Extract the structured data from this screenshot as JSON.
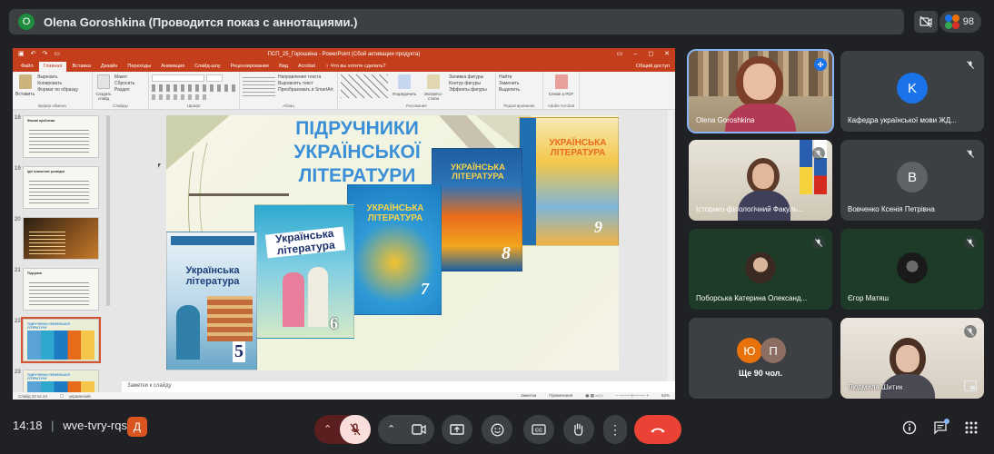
{
  "top_bar": {
    "presenter_initial": "O",
    "title": "Olena Goroshkina (Проводится показ с аннотациями.)",
    "participant_count": "98"
  },
  "ppt": {
    "window_title": "ПСП_25_Горошкіна - PowerPoint (Сбой активации продукта)",
    "tabs": [
      "Файл",
      "Главная",
      "Вставка",
      "Дизайн",
      "Переходы",
      "Анимация",
      "Слайд-шоу",
      "Рецензирование",
      "Вид",
      "Acrobat",
      "♀ Что вы хотите сделать?"
    ],
    "active_tab": "Главная",
    "share": "Общий доступ",
    "ribbon": {
      "clipboard": {
        "paste": "Вставить",
        "cut": "Вырезать",
        "copy": "Копировать",
        "format": "Формат по образцу",
        "label": "Буфер обмена"
      },
      "slides": {
        "new": "Создать слайд",
        "layout": "Макет",
        "reset": "Сбросить",
        "section": "Раздел",
        "label": "Слайды"
      },
      "font": {
        "label": "Шрифт"
      },
      "paragraph": {
        "direction": "Направление текста",
        "align": "Выровнять текст",
        "smartart": "Преобразовать в SmartArt",
        "label": "Абзац"
      },
      "drawing": {
        "arrange": "Упорядочить",
        "styles": "Экспресс-стили",
        "fill": "Заливка фигуры",
        "outline": "Контур фигуры",
        "effects": "Эффекты фигуры",
        "label": "Рисование"
      },
      "editing": {
        "find": "Найти",
        "replace": "Заменить",
        "select": "Выделить",
        "label": "Редактирование"
      },
      "acrobat": {
        "create": "Create a PDF",
        "label": "Adobe Acrobat"
      }
    },
    "thumbnails": [
      {
        "num": "18",
        "title": "Фахові проблеми"
      },
      {
        "num": "19",
        "title": "Ідеї плакатних розвідок"
      },
      {
        "num": "20",
        "title": ""
      },
      {
        "num": "21",
        "title": "Підсумки"
      },
      {
        "num": "22",
        "title": "ПІДРУЧНИКИ УКРАЇНСЬКОЇ ЛІТЕРАТУРИ"
      },
      {
        "num": "23",
        "title": "ПІДРУЧНИКИ УКРАЇНСЬКОЇ ЛІТЕРАТУРИ"
      }
    ],
    "slide": {
      "title_line1": "ПІДРУЧНИКИ",
      "title_line2": "УКРАЇНСЬКОЇ",
      "title_line3": "ЛІТЕРАТУРИ",
      "books": [
        {
          "title": "Українська література",
          "grade": "5"
        },
        {
          "title": "Українська література",
          "grade": "6"
        },
        {
          "title": "УКРАЇНСЬКА ЛІТЕРАТУРА",
          "grade": "7"
        },
        {
          "title": "УКРАЇНСЬКА ЛІТЕРАТУРА",
          "grade": "8"
        },
        {
          "title": "УКРАЇНСЬКА ЛІТЕРАТУРА",
          "grade": "9"
        }
      ]
    },
    "notes_placeholder": "Заметки к слайду",
    "status": {
      "slide_of": "Слайд 22 из 24",
      "lang": "украинский",
      "notes": "Заметки",
      "comments": "Примечания",
      "zoom": "62%"
    }
  },
  "participants": [
    {
      "name": "Olena Goroshkina",
      "type": "video",
      "speaking": true
    },
    {
      "name": "Кафедра української мови ЖД...",
      "initial": "K",
      "avatar_color": "#1a73e8",
      "muted": true
    },
    {
      "name": "Історико-філологічний Факуль...",
      "type": "video",
      "muted": true
    },
    {
      "name": "Вовченко Ксенія Петрівна",
      "initial": "B",
      "avatar_color": "#5f6368",
      "muted": true
    },
    {
      "name": "Поборська Катерина Олександ...",
      "type": "photo",
      "muted": true
    },
    {
      "name": "Єгор Матяш",
      "type": "photo",
      "muted": true
    },
    {
      "name": "Ще 90 чол.",
      "initials": [
        "Ю",
        "П"
      ]
    },
    {
      "name": "Людмила Шитик",
      "type": "video",
      "muted": true
    }
  ],
  "bottom_bar": {
    "time": "14:18",
    "separator": "|",
    "meeting_code": "wve-tvry-rqs",
    "activity_letter": "Д"
  },
  "colors": {
    "end_call": "#ea4335",
    "mic_off_bg": "#f9dedc",
    "ppt_orange": "#c43e1c"
  }
}
